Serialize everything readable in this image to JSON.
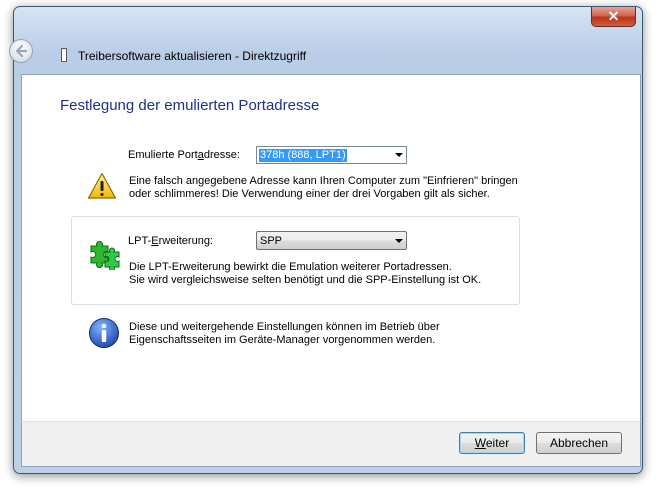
{
  "window": {
    "title": "Treibersoftware aktualisieren - Direktzugriff",
    "close_glyph": "✕"
  },
  "page": {
    "heading": "Festlegung der emulierten Portadresse"
  },
  "port_address": {
    "label_pre": "Emulierte Port",
    "label_accel": "a",
    "label_post": "dresse:",
    "selected_value": "378h (888, LPT1)"
  },
  "warning": {
    "icon": "warning-icon",
    "line1": "Eine falsch angegebene Adresse kann Ihren Computer zum \"Einfrieren\" bringen",
    "line2": "oder schlimmeres! Die Verwendung einer der drei Vorgaben gilt als sicher."
  },
  "lpt": {
    "label_pre": "LPT-",
    "label_accel": "E",
    "label_post": "rweiterung:",
    "selected_value": "SPP",
    "icon": "puzzle-pieces-icon",
    "line1": "Die LPT-Erweiterung bewirkt die Emulation weiterer Portadressen.",
    "line2": "Sie wird vergleichsweise selten benötigt und die SPP-Einstellung ist OK."
  },
  "info": {
    "icon": "info-icon",
    "line1": "Diese und weitergehende Einstellungen können im Betrieb über",
    "line2": "Eigenschaftsseiten im Geräte-Manager vorgenommen werden."
  },
  "buttons": {
    "next_accel": "W",
    "next_rest": "eiter",
    "cancel": "Abbrechen"
  },
  "colors": {
    "heading": "#1e3287",
    "selection": "#3399ff",
    "frame": "#bcd0e8"
  }
}
